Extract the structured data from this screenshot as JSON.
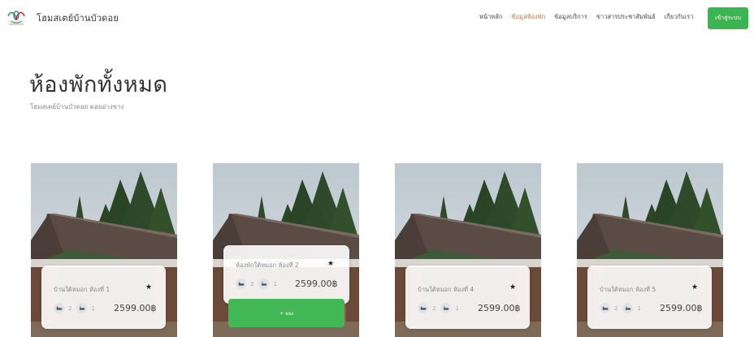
{
  "header": {
    "brand": "โฮมสเตย์บ้านบัวดอย",
    "nav": [
      {
        "label": "หน้าหลัก",
        "active": false
      },
      {
        "label": "ข้อมูลห้องพัก",
        "active": true
      },
      {
        "label": "ข้อมูลบริการ",
        "active": false
      },
      {
        "label": "ข่าวสารประชาสัมพันธ์",
        "active": false
      },
      {
        "label": "เกี่ยวกับเรา",
        "active": false
      }
    ],
    "login_label": "เข้าสู่ระบบ"
  },
  "page": {
    "title": "ห้องพักทั้งหมด",
    "subtitle": "โฮมสเตย์บ้านบัวดอย ดอยอ่างขาง"
  },
  "rooms": [
    {
      "name": "บ้านใต้หมอก ห้องที่ 1",
      "beds": "2",
      "baths": "1",
      "price": "2599.00฿",
      "rating_icon": "star-icon"
    },
    {
      "name": "ห้องพักใต้หมอก ห้องที่ 2",
      "beds": "2",
      "baths": "1",
      "price": "2599.00฿",
      "rating_icon": "star-icon",
      "button": "+ จอง"
    },
    {
      "name": "บ้านใต้หมอก ห้องที่ 4",
      "beds": "2",
      "baths": "1",
      "price": "2599.00฿",
      "rating_icon": "star-icon"
    },
    {
      "name": "บ้านใต้หมอก ห้องที่ 5",
      "beds": "2",
      "baths": "1",
      "price": "2599.00฿",
      "rating_icon": "star-icon"
    }
  ],
  "colors": {
    "accent": "#3db454",
    "active_nav": "#c0703a"
  }
}
